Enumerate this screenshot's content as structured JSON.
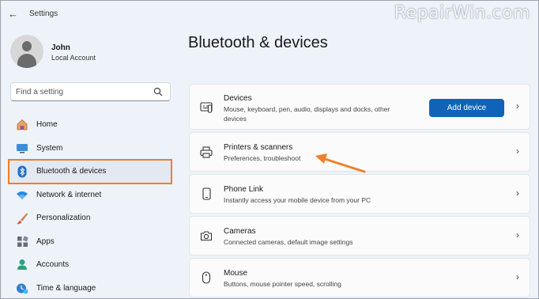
{
  "window": {
    "title": "Settings",
    "back_glyph": "←",
    "minimize_glyph": "—",
    "maximize_glyph": "☐",
    "close_glyph": "✕"
  },
  "watermark": "RepairWin.com",
  "user": {
    "name": "John",
    "account": "Local Account"
  },
  "search": {
    "placeholder": "Find a setting",
    "icon": "search-icon"
  },
  "sidebar": {
    "items": [
      {
        "label": "Home",
        "icon": "home-icon"
      },
      {
        "label": "System",
        "icon": "system-icon"
      },
      {
        "label": "Bluetooth & devices",
        "icon": "bluetooth-icon",
        "active": true
      },
      {
        "label": "Network & internet",
        "icon": "wifi-icon"
      },
      {
        "label": "Personalization",
        "icon": "brush-icon"
      },
      {
        "label": "Apps",
        "icon": "apps-icon"
      },
      {
        "label": "Accounts",
        "icon": "accounts-icon"
      },
      {
        "label": "Time & language",
        "icon": "time-language-icon"
      }
    ]
  },
  "main": {
    "title": "Bluetooth & devices",
    "cards": [
      {
        "title": "Devices",
        "subtitle": "Mouse, keyboard, pen, audio, displays and docks, other devices",
        "icon": "devices-icon",
        "button": "Add device"
      },
      {
        "title": "Printers & scanners",
        "subtitle": "Preferences, troubleshoot",
        "icon": "printer-icon"
      },
      {
        "title": "Phone Link",
        "subtitle": "Instantly access your mobile device from your PC",
        "icon": "phone-icon"
      },
      {
        "title": "Cameras",
        "subtitle": "Connected cameras, default image settings",
        "icon": "camera-icon"
      },
      {
        "title": "Mouse",
        "subtitle": "Buttons, mouse pointer speed, scrolling",
        "icon": "mouse-icon"
      }
    ],
    "chevron_glyph": "›"
  },
  "colors": {
    "accent": "#0f64b7",
    "highlight": "#f07f28",
    "background": "#eef2f9"
  }
}
